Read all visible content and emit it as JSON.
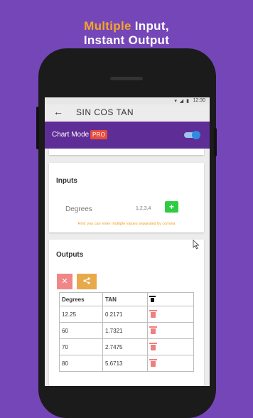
{
  "headline": {
    "line1_accent": "Multiple",
    "line1_rest": " Input,",
    "line2": "Instant Output"
  },
  "status_bar": {
    "time": "12:30"
  },
  "app_bar": {
    "title": "SIN COS TAN"
  },
  "mode_bar": {
    "label": "Chart Mode",
    "badge": "PRO",
    "toggle_on": true
  },
  "inputs": {
    "title": "Inputs",
    "field_label": "Degrees",
    "field_value": "1,2,3,4",
    "add_label": "+",
    "hint": "Hint: you can enter multiple values separated by comma"
  },
  "outputs": {
    "title": "Outputs",
    "clear_label": "✕",
    "columns": [
      "Degrees",
      "TAN"
    ],
    "rows": [
      [
        "12.25",
        "0.2171"
      ],
      [
        "60",
        "1.7321"
      ],
      [
        "70",
        "2.7475"
      ],
      [
        "80",
        "5.6713"
      ]
    ]
  },
  "colors": {
    "background": "#7546b8",
    "accent": "#f5a623",
    "mode_bar": "#5f2d96",
    "pro_badge": "#e74c3c",
    "add_button": "#2ecc40",
    "clear_button": "#f08686",
    "share_button": "#e8a94b"
  },
  "icons": [
    "back-arrow-icon",
    "share-icon",
    "trash-icon",
    "wifi-icon",
    "signal-icon",
    "battery-icon"
  ]
}
